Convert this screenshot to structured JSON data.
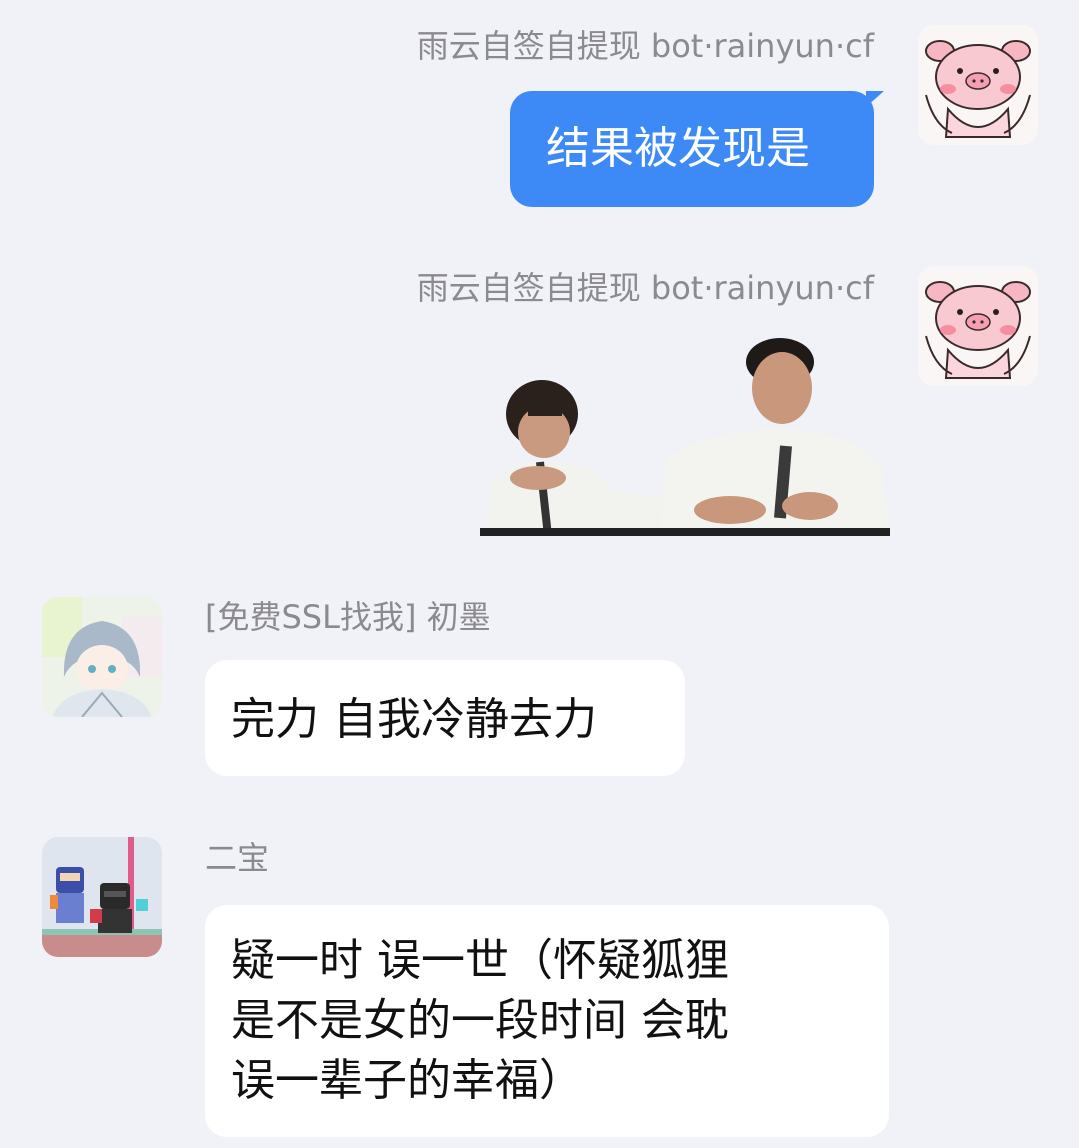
{
  "messages": [
    {
      "direction": "outgoing",
      "sender": "雨云自签自提现 bot·rainyun·cf",
      "avatar": "pink-pig-avatar",
      "text": "结果被发现是"
    },
    {
      "direction": "outgoing",
      "sender": "雨云自签自提现 bot·rainyun·cf",
      "avatar": "pink-pig-avatar",
      "sticker": "two-men-in-white-shirts-sticker"
    },
    {
      "direction": "incoming",
      "sender": "[免费SSL找我] 初墨",
      "avatar": "anime-character-avatar",
      "text": "完力 自我冷静去力"
    },
    {
      "direction": "incoming",
      "sender": "二宝",
      "avatar": "pixel-game-characters-avatar",
      "lines": [
        "疑一时 误一世（怀疑狐狸",
        "是不是女的一段时间 会耽",
        "误一辈子的幸福）"
      ]
    }
  ],
  "colors": {
    "background": "#f1f2f7",
    "outgoing_bubble": "#3d8af7",
    "incoming_bubble": "#ffffff",
    "sender_name": "#8a8a8f"
  }
}
